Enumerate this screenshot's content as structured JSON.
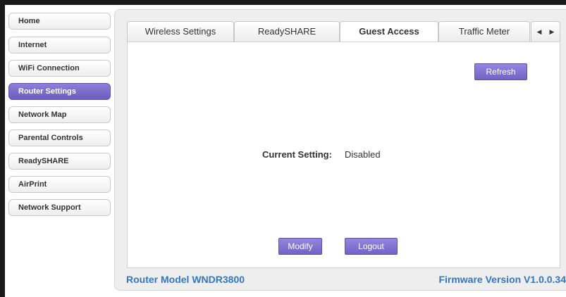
{
  "sidebar": {
    "items": [
      {
        "label": "Home",
        "active": false
      },
      {
        "label": "Internet",
        "active": false
      },
      {
        "label": "WiFi Connection",
        "active": false
      },
      {
        "label": "Router Settings",
        "active": true
      },
      {
        "label": "Network Map",
        "active": false
      },
      {
        "label": "Parental Controls",
        "active": false
      },
      {
        "label": "ReadySHARE",
        "active": false
      },
      {
        "label": "AirPrint",
        "active": false
      },
      {
        "label": "Network Support",
        "active": false
      }
    ]
  },
  "tabs": [
    {
      "label": "Wireless Settings",
      "active": false
    },
    {
      "label": "ReadySHARE",
      "active": false
    },
    {
      "label": "Guest Access",
      "active": true
    },
    {
      "label": "Traffic Meter",
      "active": false
    }
  ],
  "tab_arrows": {
    "left": "◀",
    "right": "▶"
  },
  "content": {
    "refresh_label": "Refresh",
    "current_setting_label": "Current Setting:",
    "current_setting_value": "Disabled",
    "modify_label": "Modify",
    "logout_label": "Logout"
  },
  "footer": {
    "model": "Router Model WNDR3800",
    "firmware": "Firmware Version V1.0.0.34"
  },
  "colors": {
    "accent": "#7262c7",
    "footer_text": "#2f78c4"
  }
}
